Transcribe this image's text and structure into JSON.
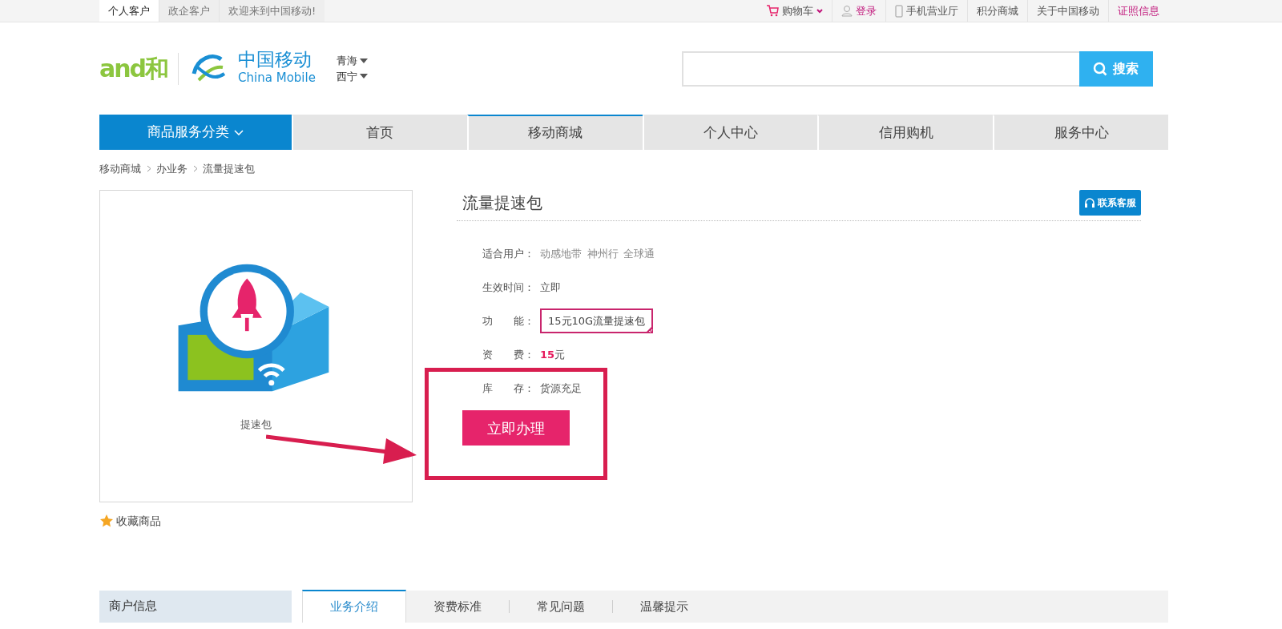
{
  "top_bar": {
    "tabs": [
      {
        "label": "个人客户",
        "selected": true
      },
      {
        "label": "政企客户",
        "selected": false
      }
    ],
    "welcome": "欢迎来到中国移动!",
    "links": [
      {
        "kind": "cart",
        "label": "购物车"
      },
      {
        "kind": "login",
        "label": "登录"
      },
      {
        "kind": "phone",
        "label": "手机营业厅"
      },
      {
        "kind": "plain",
        "label": "积分商城"
      },
      {
        "kind": "plain",
        "label": "关于中国移动"
      },
      {
        "kind": "accent",
        "label": "证照信息"
      }
    ]
  },
  "header": {
    "and_logo": "and和",
    "logo_cn": "中国移动",
    "logo_en": "China Mobile",
    "province": "青海",
    "city": "西宁",
    "search_button": "搜索"
  },
  "nav": {
    "category": "商品服务分类",
    "items": [
      {
        "label": "首页",
        "selected": false
      },
      {
        "label": "移动商城",
        "selected": true
      },
      {
        "label": "个人中心",
        "selected": false
      },
      {
        "label": "信用购机",
        "selected": false
      },
      {
        "label": "服务中心",
        "selected": false
      }
    ]
  },
  "breadcrumb": [
    "移动商城",
    "办业务",
    "流量提速包"
  ],
  "product": {
    "image_label": "提速包",
    "title": "流量提速包",
    "contact_button": "联系客服",
    "attributes": [
      {
        "kind": "tags",
        "label": "适合用户：",
        "values": [
          "动感地带",
          "神州行",
          "全球通"
        ]
      },
      {
        "kind": "text",
        "label": "生效时间：",
        "values": [
          "立即"
        ]
      },
      {
        "kind": "options",
        "label": "功　　能：",
        "options": [
          {
            "label": "15元10G流量提速包",
            "selected": true
          }
        ]
      },
      {
        "kind": "price",
        "label": "资　　费：",
        "values": [
          "**15**元"
        ]
      },
      {
        "kind": "text",
        "label": "库　　存：",
        "values": [
          "货源充足"
        ]
      }
    ],
    "buy_button": "立即办理",
    "favorite": "收藏商品"
  },
  "bottom": {
    "sidebar_title": "商户信息",
    "tabs": [
      {
        "label": "业务介绍",
        "selected": true
      },
      {
        "label": "资费标准",
        "selected": false
      },
      {
        "label": "常见问题",
        "selected": false
      },
      {
        "label": "温馨提示",
        "selected": false
      }
    ]
  }
}
